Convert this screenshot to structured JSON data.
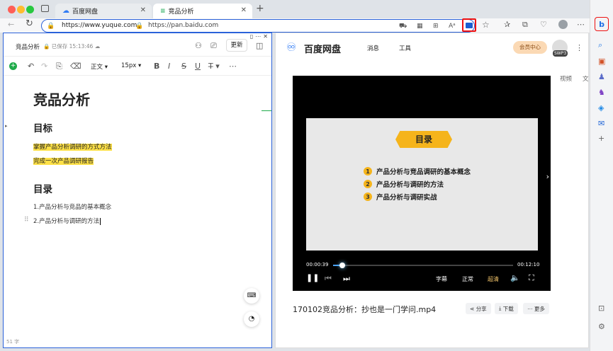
{
  "tabs": [
    {
      "label": "百度网盘"
    },
    {
      "label": "竞品分析"
    }
  ],
  "address": {
    "left_url": "https://www.yuque.com",
    "right_url": "https://pan.baidu.com"
  },
  "editor": {
    "doc_title": "竞品分析",
    "save_status": "已保存 15:13:46",
    "update_btn": "更新",
    "style_select": "正文",
    "size_select": "15px",
    "heading": "竞品分析",
    "section1": "目标",
    "goal1": "掌握产品分析调研的方式方法",
    "goal2": "完成一次产品调研报告",
    "section2": "目录",
    "toc1": "1.产品分析与竞品的基本概念",
    "toc2": "2.产品分析与调研的方法",
    "word_count": "51 字"
  },
  "pan": {
    "logo": "百度网盘",
    "nav1": "消息",
    "nav2": "工具",
    "vip": "会员中心",
    "badge": "SWP3",
    "side_tab1": "视频",
    "side_tab2": "文",
    "slide_title": "目录",
    "items": [
      "产品分析与竞品调研的基本概念",
      "产品分析与调研的方法",
      "产品分析与调研实战"
    ],
    "item_nums": [
      "1",
      "2",
      "3"
    ],
    "time_now": "00:00:39",
    "time_total": "00:12:10",
    "progress": 0.053,
    "ctrl1": "字幕",
    "ctrl2": "正常",
    "ctrl3": "超清",
    "filename": "170102竞品分析：抄也是一门学问.mp4",
    "share": "分享",
    "download": "下载",
    "more": "更多"
  }
}
